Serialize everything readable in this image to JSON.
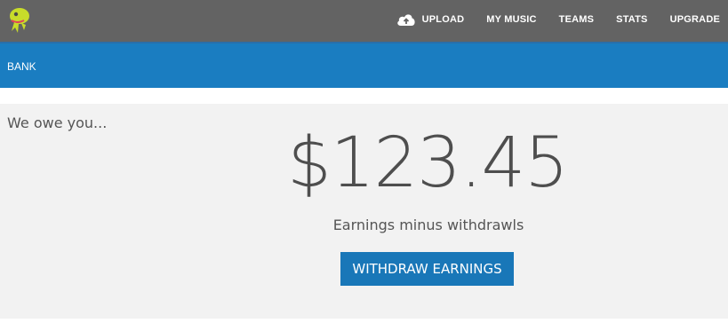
{
  "header": {
    "logo_icon": "frog-mascot-logo",
    "nav": [
      {
        "label": "UPLOAD",
        "icon": "cloud-upload-icon"
      },
      {
        "label": "MY MUSIC"
      },
      {
        "label": "TEAMS"
      },
      {
        "label": "STATS"
      },
      {
        "label": "UPGRADE"
      }
    ]
  },
  "section_bar": {
    "label": "BANK"
  },
  "main": {
    "owe_label": "We owe you...",
    "amount": "$123.45",
    "subtitle": "Earnings minus withdrawls",
    "withdraw_button": "WITHDRAW EARNINGS"
  },
  "colors": {
    "topbar": "#636363",
    "accent_blue": "#1a7dc1",
    "logo_green": "#c8dc2a",
    "panel_bg": "#f2f2f2"
  }
}
